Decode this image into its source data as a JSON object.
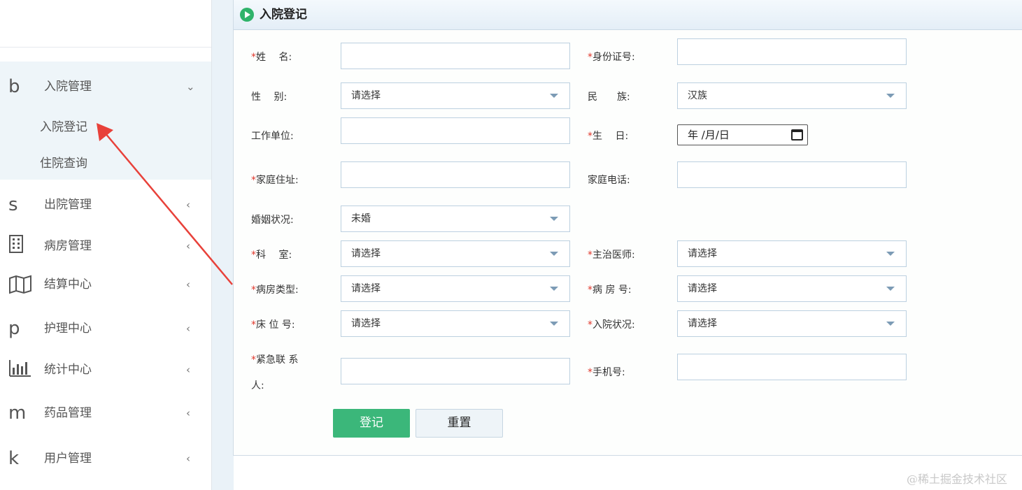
{
  "sidebar": {
    "items": [
      {
        "icon": "b",
        "label": "入院管理",
        "chevron": "⌄",
        "expanded": true
      },
      {
        "icon": "s",
        "label": "出院管理",
        "chevron": "‹"
      },
      {
        "icon": "building-icon",
        "label": "病房管理",
        "chevron": "‹"
      },
      {
        "icon": "map-icon",
        "label": "结算中心",
        "chevron": "‹"
      },
      {
        "icon": "p",
        "label": "护理中心",
        "chevron": "‹"
      },
      {
        "icon": "bar-chart-icon",
        "label": "统计中心",
        "chevron": "‹"
      },
      {
        "icon": "m",
        "label": "药品管理",
        "chevron": "‹"
      },
      {
        "icon": "k",
        "label": "用户管理",
        "chevron": "‹"
      }
    ],
    "sub_items": [
      "入院登记",
      "住院查询"
    ]
  },
  "panel": {
    "title": "入院登记"
  },
  "form": {
    "name_label": "姓　 名:",
    "id_label": "身份证号:",
    "gender_label": "性　 别:",
    "gender_value": "请选择",
    "ethnic_label": "民　　族:",
    "ethnic_value": "汉族",
    "work_label": "工作单位:",
    "birth_label": "生　 日:",
    "birth_placeholder": "年 /月/日",
    "address_label": "家庭住址:",
    "phone_label": "家庭电话:",
    "marital_label": "婚姻状况:",
    "marital_value": "未婚",
    "dept_label": "科　 室:",
    "dept_value": "请选择",
    "doctor_label": "主治医师:",
    "doctor_value": "请选择",
    "roomtype_label": "病房类型:",
    "roomtype_value": "请选择",
    "roomno_label": "病 房 号:",
    "roomno_value": "请选择",
    "bed_label": "床 位 号:",
    "bed_value": "请选择",
    "status_label": "入院状况:",
    "status_value": "请选择",
    "contact_label_1": "紧急联 系",
    "contact_label_2": "人:",
    "mobile_label": "手机号:",
    "required_mark": "*"
  },
  "buttons": {
    "submit": "登记",
    "reset": "重置"
  },
  "watermark": "@稀土掘金技术社区",
  "colors": {
    "primary": "#3bb77a",
    "required": "#e0372b",
    "arrow": "#e8413a",
    "sidebar_active_bg": "#eef5f9"
  }
}
